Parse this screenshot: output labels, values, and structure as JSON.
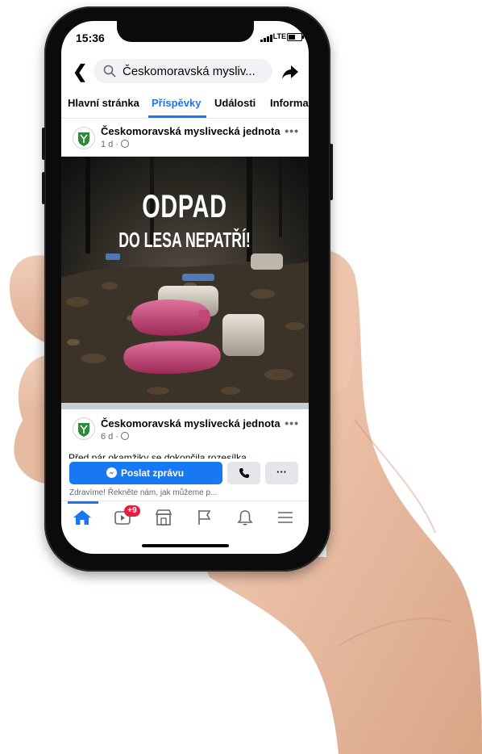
{
  "status": {
    "time": "15:36",
    "network": "LTE"
  },
  "search": {
    "query": "Českomoravská mysliv..."
  },
  "tabs": [
    {
      "label": "Hlavní stránka"
    },
    {
      "label": "Příspěvky"
    },
    {
      "label": "Události"
    },
    {
      "label": "Informa"
    }
  ],
  "posts": [
    {
      "author": "Českomoravská myslivecká jednota",
      "meta": "1 d ·",
      "more": "•••"
    },
    {
      "author": "Českomoravská myslivecká jednota",
      "meta": "6 d ·",
      "more": "•••",
      "text": "Před pár okamžiky se dokončila rozesílka"
    }
  ],
  "post_image": {
    "line1": "ODPAD",
    "line2": "DO LESA NEPATŘÍ!"
  },
  "actions": {
    "message_label": "Poslat zprávu",
    "more_label": "···",
    "greeting": "Zdravíme! Řekněte nám, jak můžeme p..."
  },
  "nav": {
    "video_badge": "+9"
  },
  "colors": {
    "accent": "#1877f2",
    "badge": "#e41e3f",
    "logo_green": "#2e8b3a"
  }
}
